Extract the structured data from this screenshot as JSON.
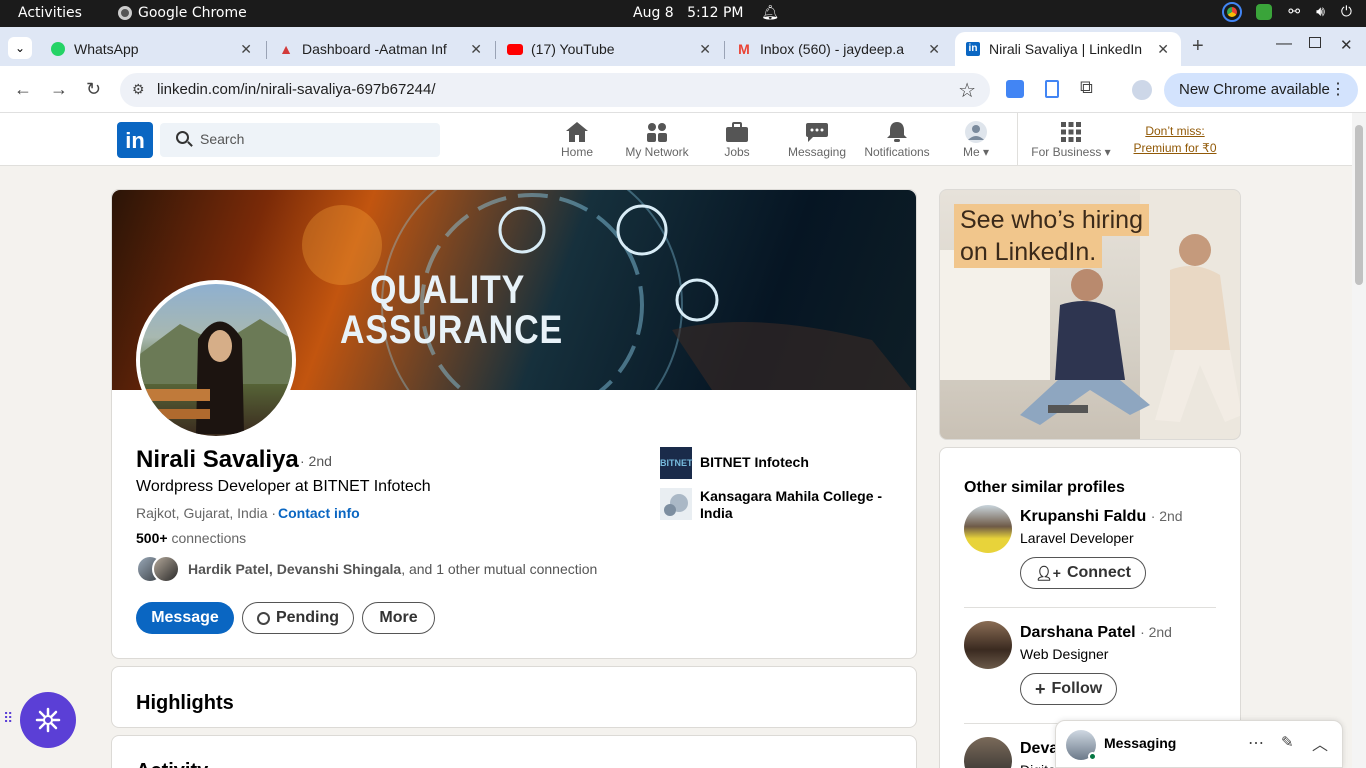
{
  "system": {
    "activities": "Activities",
    "app_name": "Google Chrome",
    "date": "Aug 8",
    "time": "5:12 PM"
  },
  "tabs": [
    {
      "title": "WhatsApp",
      "icon": "whatsapp-icon",
      "color": "#25d366"
    },
    {
      "title": "Dashboard -Aatman Inf",
      "icon": "aatman-icon",
      "color": "#d23a3a"
    },
    {
      "title": "(17) YouTube",
      "icon": "youtube-icon",
      "color": "#ff0000"
    },
    {
      "title": "Inbox (560) - jaydeep.a",
      "icon": "gmail-icon",
      "color": "#ea4335"
    },
    {
      "title": "Nirali Savaliya | LinkedIn",
      "icon": "linkedin-icon",
      "color": "#0a66c2"
    }
  ],
  "address": {
    "url": "linkedin.com/in/nirali-savaliya-697b67244/",
    "new_chrome": "New Chrome available"
  },
  "linkedin_nav": {
    "search_placeholder": "Search",
    "items": [
      "Home",
      "My Network",
      "Jobs",
      "Messaging",
      "Notifications",
      "Me",
      "For Business"
    ],
    "premium_line1": "Don’t miss:",
    "premium_line2": "Premium for ₹0"
  },
  "profile": {
    "banner_line1": "QUALITY",
    "banner_line2": "ASSURANCE",
    "name": "Nirali Savaliya",
    "degree": "· 2nd",
    "headline": "Wordpress Developer at BITNET Infotech",
    "location": "Rajkot, Gujarat, India ·",
    "contact_info": "Contact info",
    "connections_count": "500+",
    "connections_label": "connections",
    "mutual_names": "Hardik Patel, Devanshi Shingala",
    "mutual_rest": ", and 1 other mutual connection",
    "btn_message": "Message",
    "btn_pending": "Pending",
    "btn_more": "More",
    "org1": "BITNET Infotech",
    "org2": "Kansagara Mahila College - India"
  },
  "highlights_title": "Highlights",
  "activity_title": "Activity",
  "ad": {
    "line1": "See who’s hiring",
    "line2": "on LinkedIn."
  },
  "similar": {
    "title": "Other similar profiles",
    "people": [
      {
        "name": "Krupanshi Faldu",
        "degree": "· 2nd",
        "role": "Laravel Developer",
        "action": "Connect"
      },
      {
        "name": "Darshana Patel",
        "degree": "· 2nd",
        "role": "Web Designer",
        "action": "Follow"
      },
      {
        "name": "Deva",
        "degree": "",
        "role": "Digita",
        "action": ""
      }
    ]
  },
  "messaging": {
    "label": "Messaging"
  }
}
